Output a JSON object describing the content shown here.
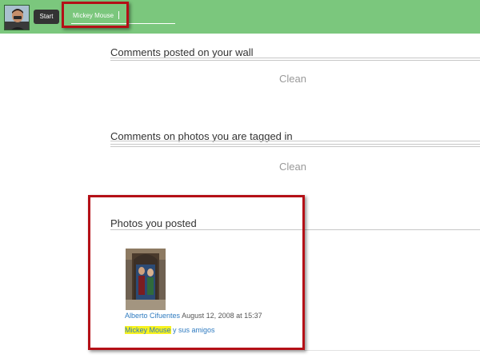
{
  "topbar": {
    "start_label": "Start",
    "search": {
      "value": "Mickey Mouse",
      "placeholder": ""
    },
    "colors": {
      "bar": "#7bc77d",
      "button": "#333333"
    }
  },
  "sections": {
    "wall": {
      "title": "Comments posted on your wall",
      "status": "Clean"
    },
    "tagged": {
      "title": "Comments on photos you are tagged in",
      "status": "Clean"
    },
    "posted": {
      "title": "Photos you posted",
      "photo": {
        "author": "Alberto Cifuentes",
        "date": "August 12, 2008 at 15:37",
        "caption_highlight": "Mickey Mouse",
        "caption_rest": " y sus amigos"
      }
    }
  },
  "highlight_color": "#b41017",
  "icons": [
    "user-avatar",
    "photo-thumbnail"
  ]
}
